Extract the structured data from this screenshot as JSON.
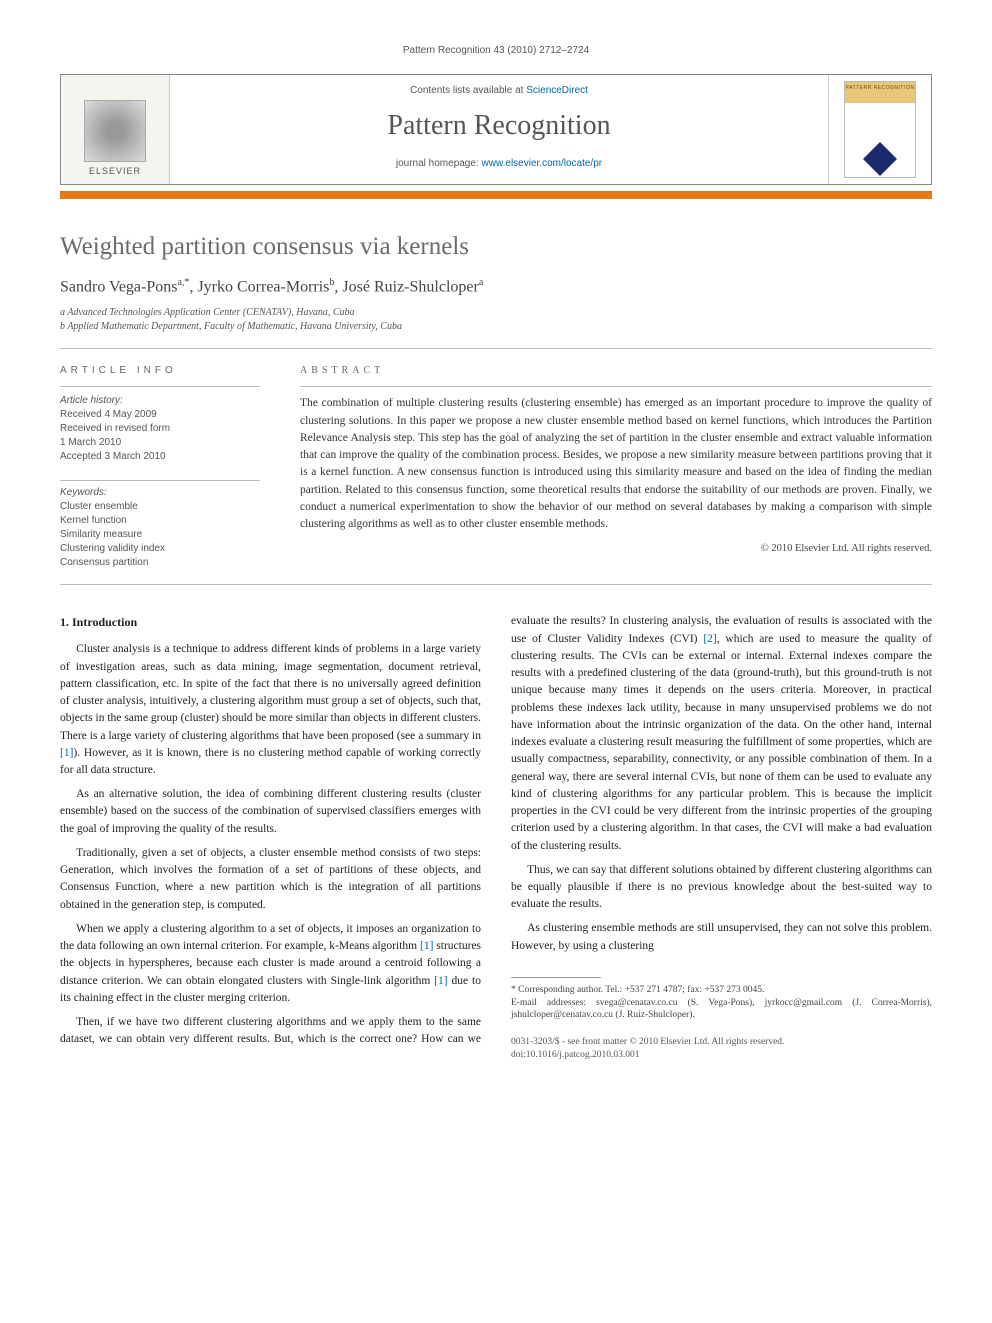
{
  "running_header": "Pattern Recognition 43 (2010) 2712–2724",
  "banner": {
    "contents_prefix": "Contents lists available at ",
    "contents_link": "ScienceDirect",
    "journal_title": "Pattern Recognition",
    "homepage_prefix": "journal homepage: ",
    "homepage_link": "www.elsevier.com/locate/pr",
    "publisher_name": "ELSEVIER",
    "cover_label": "PATTERN RECOGNITION"
  },
  "article": {
    "title": "Weighted partition consensus via kernels",
    "authors_html": "Sandro Vega-Pons",
    "authors": [
      {
        "name": "Sandro Vega-Pons",
        "marks": "a,*"
      },
      {
        "name": "Jyrko Correa-Morris",
        "marks": "b"
      },
      {
        "name": "José Ruiz-Shulcloper",
        "marks": "a"
      }
    ],
    "affiliations": [
      "a Advanced Technologies Application Center (CENATAV), Havana, Cuba",
      "b Applied Mathematic Department, Faculty of Mathematic, Havana University, Cuba"
    ]
  },
  "article_info": {
    "heading": "ARTICLE INFO",
    "history_label": "Article history:",
    "history": [
      "Received 4 May 2009",
      "Received in revised form",
      "1 March 2010",
      "Accepted 3 March 2010"
    ],
    "keywords_label": "Keywords:",
    "keywords": [
      "Cluster ensemble",
      "Kernel function",
      "Similarity measure",
      "Clustering validity index",
      "Consensus partition"
    ]
  },
  "abstract": {
    "heading": "ABSTRACT",
    "text": "The combination of multiple clustering results (clustering ensemble) has emerged as an important procedure to improve the quality of clustering solutions. In this paper we propose a new cluster ensemble method based on kernel functions, which introduces the Partition Relevance Analysis step. This step has the goal of analyzing the set of partition in the cluster ensemble and extract valuable information that can improve the quality of the combination process. Besides, we propose a new similarity measure between partitions proving that it is a kernel function. A new consensus function is introduced using this similarity measure and based on the idea of finding the median partition. Related to this consensus function, some theoretical results that endorse the suitability of our methods are proven. Finally, we conduct a numerical experimentation to show the behavior of our method on several databases by making a comparison with simple clustering algorithms as well as to other cluster ensemble methods.",
    "copyright": "© 2010 Elsevier Ltd. All rights reserved."
  },
  "section1": {
    "heading": "1.  Introduction",
    "p1": "Cluster analysis is a technique to address different kinds of problems in a large variety of investigation areas, such as data mining, image segmentation, document retrieval, pattern classification, etc. In spite of the fact that there is no universally agreed definition of cluster analysis, intuitively, a clustering algorithm must group a set of objects, such that, objects in the same group (cluster) should be more similar than objects in different clusters. There is a large variety of clustering algorithms that have been proposed (see a summary in ",
    "p1_ref": "[1]",
    "p1_tail": "). However, as it is known, there is no clustering method capable of working correctly for all data structure.",
    "p2": "As an alternative solution, the idea of combining different clustering results (cluster ensemble) based on the success of the combination of supervised classifiers emerges with the goal of improving the quality of the results.",
    "p3": "Traditionally, given a set of objects, a cluster ensemble method consists of two steps: Generation, which involves the formation of a set of partitions of these objects, and Consensus Function, where a new partition which is the integration of all partitions obtained in the generation step, is computed.",
    "p4a": "When we apply a clustering algorithm to a set of objects, it imposes an organization to the data following an own internal criterion. For example, k-Means algorithm ",
    "p4_ref": "[1]",
    "p4b": " structures the objects in hyperspheres, because each cluster is made around a centroid following a distance criterion. We can obtain elongated clusters with Single-link algorithm ",
    "p4_ref2": "[1]",
    "p4c": " due to its chaining effect in the cluster merging criterion.",
    "p5a": "Then, if we have two different clustering algorithms and we apply them to the same dataset, we can obtain very different results. But, which is the correct one? How can we evaluate the results? In clustering analysis, the evaluation of results is associated with the use of Cluster Validity Indexes (CVI) ",
    "p5_ref": "[2]",
    "p5b": ", which are used to measure the quality of clustering results. The CVIs can be external or internal. External indexes compare the results with a predefined clustering of the data (ground-truth), but this ground-truth is not unique because many times it depends on the users criteria. Moreover, in practical problems these indexes lack utility, because in many unsupervised problems we do not have information about the intrinsic organization of the data. On the other hand, internal indexes evaluate a clustering result measuring the fulfillment of some properties, which are usually compactness, separability, connectivity, or any possible combination of them. In a general way, there are several internal CVIs, but none of them can be used to evaluate any kind of clustering algorithms for any particular problem. This is because the implicit properties in the CVI could be very different from the intrinsic properties of the grouping criterion used by a clustering algorithm. In that cases, the CVI will make a bad evaluation of the clustering results.",
    "p6": "Thus, we can say that different solutions obtained by different clustering algorithms can be equally plausible if there is no previous knowledge about the best-suited way to evaluate the results.",
    "p7": "As clustering ensemble methods are still unsupervised, they can not solve this problem. However, by using a clustering"
  },
  "footnotes": {
    "corr": "* Corresponding author. Tel.: +537 271 4787; fax: +537 273 0045.",
    "emails": "E-mail addresses: svega@cenatav.co.cu (S. Vega-Pons), jyrkocc@gmail.com (J. Correa-Morris), jshulcloper@cenatav.co.cu (J. Ruiz-Shulcloper)."
  },
  "footer": {
    "line1": "0031-3203/$ - see front matter © 2010 Elsevier Ltd. All rights reserved.",
    "line2": "doi:10.1016/j.patcog.2010.03.001"
  }
}
